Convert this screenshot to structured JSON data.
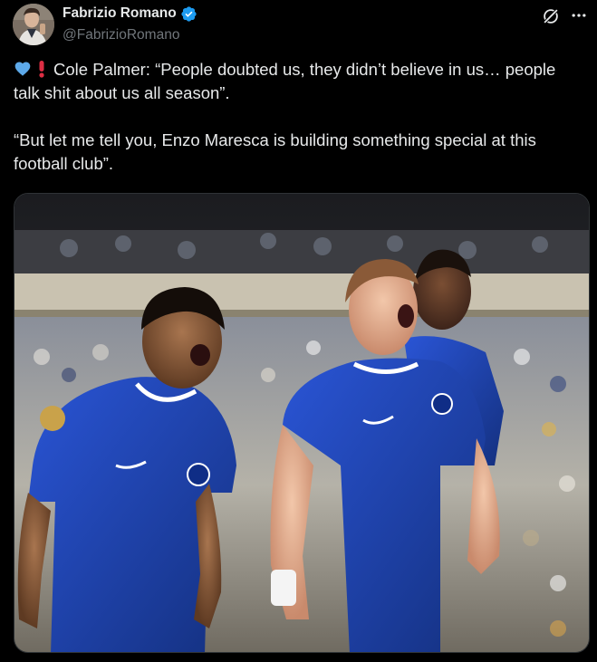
{
  "author": {
    "display_name": "Fabrizio Romano",
    "handle": "@FabrizioRomano",
    "verified": true,
    "avatar_icon": "profile-photo"
  },
  "icons": {
    "verified": "verified-badge-icon",
    "grok": "grok-icon",
    "more": "more-options-icon"
  },
  "tweet": {
    "line1_emoji": [
      "blue-heart",
      "red-exclamation"
    ],
    "paragraph1": "Cole Palmer: “People doubted us, they didn’t believe in us… people talk shit about us all season”.",
    "paragraph2": "“But let me tell you, Enzo Maresca is building something special at this football club”."
  },
  "media": {
    "type": "photo"
  },
  "colors": {
    "background": "#000000",
    "text": "#e7e9ea",
    "secondary_text": "#71767b",
    "verified_blue": "#1d9bf0",
    "kit_blue": "#1f3fa8",
    "heart_blue": "#5da9e9",
    "exclamation_red": "#dd2e44"
  }
}
